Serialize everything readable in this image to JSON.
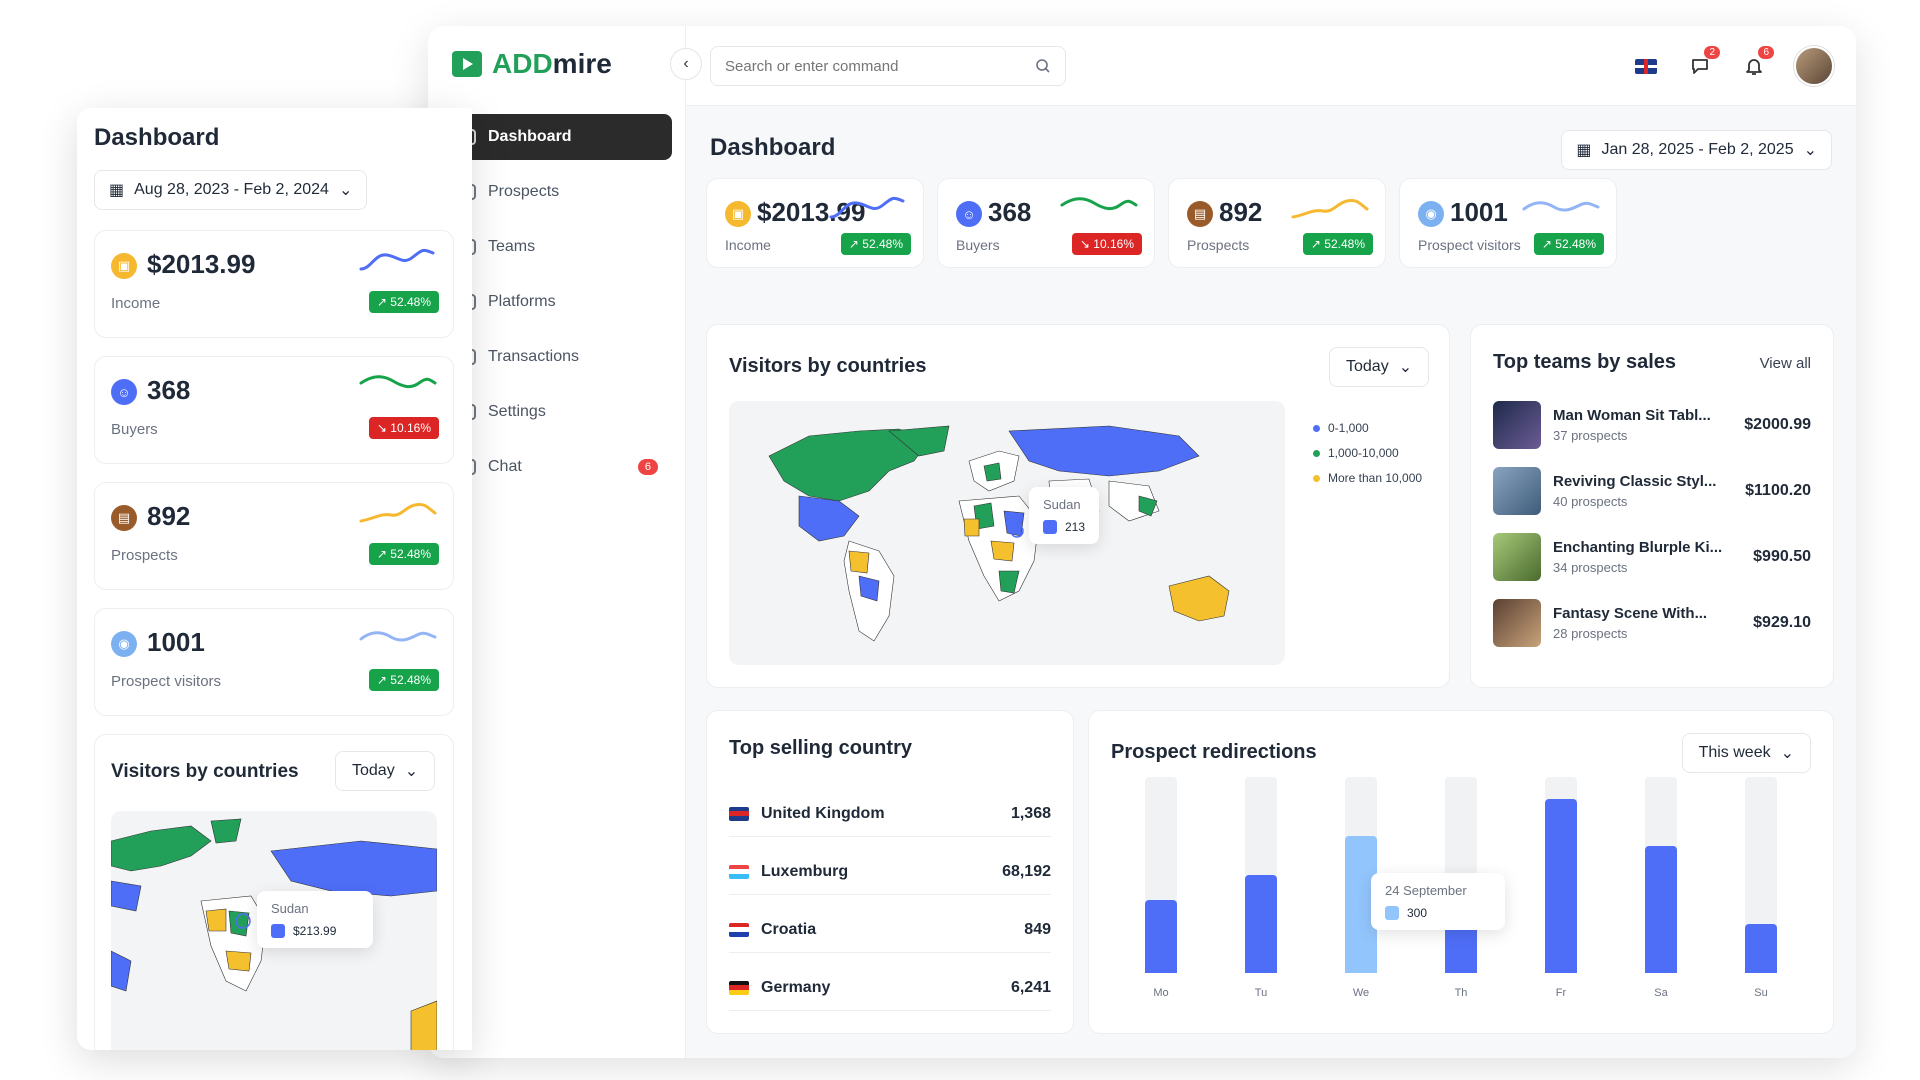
{
  "app": {
    "brand_green": "ADD",
    "brand_dark": "mire"
  },
  "nav": {
    "items": [
      {
        "label": "Dashboard",
        "active": true
      },
      {
        "label": "Prospects"
      },
      {
        "label": "Teams"
      },
      {
        "label": "Platforms"
      },
      {
        "label": "Transactions"
      },
      {
        "label": "Settings"
      },
      {
        "label": "Chat",
        "badge": "6"
      }
    ]
  },
  "topbar": {
    "search_placeholder": "Search or enter command",
    "messages_badge": "2",
    "notifications_badge": "6"
  },
  "main": {
    "title": "Dashboard",
    "date_range": "Jan 28, 2025 - Feb 2, 2025",
    "kpis": [
      {
        "value": "$2013.99",
        "label": "Income",
        "change": "52.48%",
        "trend": "up",
        "color": "#4f6ef7",
        "icon_color": "#f5b82e"
      },
      {
        "value": "368",
        "label": "Buyers",
        "change": "10.16%",
        "trend": "down",
        "color": "#16a34a",
        "icon_color": "#4f6ef7"
      },
      {
        "value": "892",
        "label": "Prospects",
        "change": "52.48%",
        "trend": "up",
        "color": "#f5b82e",
        "icon_color": "#9a5b2a"
      },
      {
        "value": "1001",
        "label": "Prospect visitors",
        "change": "52.48%",
        "trend": "up",
        "color": "#93b4f5",
        "icon_color": "#7cb0f0"
      }
    ],
    "visitors": {
      "title": "Visitors by countries",
      "period": "Today",
      "legend": [
        {
          "label": "0-1,000",
          "color": "#4f6ef7"
        },
        {
          "label": "1,000-10,000",
          "color": "#22a05a"
        },
        {
          "label": "More than 10,000",
          "color": "#f5c02e"
        }
      ],
      "tooltip_country": "Sudan",
      "tooltip_value": "213"
    },
    "top_teams": {
      "title": "Top teams by sales",
      "view_all": "View all",
      "items": [
        {
          "name": "Man Woman Sit Tabl...",
          "sub": "37 prospects",
          "price": "$2000.99"
        },
        {
          "name": "Reviving Classic Styl...",
          "sub": "40 prospects",
          "price": "$1100.20"
        },
        {
          "name": "Enchanting Blurple Ki...",
          "sub": "34 prospects",
          "price": "$990.50"
        },
        {
          "name": "Fantasy Scene With...",
          "sub": "28 prospects",
          "price": "$929.10"
        }
      ]
    },
    "top_selling": {
      "title": "Top selling country",
      "items": [
        {
          "country": "United Kingdom",
          "value": "1,368"
        },
        {
          "country": "Luxemburg",
          "value": "68,192"
        },
        {
          "country": "Croatia",
          "value": "849"
        },
        {
          "country": "Germany",
          "value": "6,241"
        }
      ]
    },
    "redirections": {
      "title": "Prospect redirections",
      "period": "This week",
      "tooltip_date": "24 September",
      "tooltip_value": "300"
    }
  },
  "left": {
    "title": "Dashboard",
    "date_range": "Aug 28, 2023 - Feb 2, 2024",
    "kpis": [
      {
        "value": "$2013.99",
        "label": "Income",
        "change": "52.48%"
      },
      {
        "value": "368",
        "label": "Buyers",
        "change": "10.16%"
      },
      {
        "value": "892",
        "label": "Prospects",
        "change": "52.48%"
      },
      {
        "value": "1001",
        "label": "Prospect visitors",
        "change": "52.48%"
      }
    ],
    "visitors_title": "Visitors by countries",
    "visitors_period": "Today",
    "tooltip_country": "Sudan",
    "tooltip_value": "$213.99"
  },
  "chart_data": {
    "type": "bar",
    "categories": [
      "Mo",
      "Tu",
      "We",
      "Th",
      "Fr",
      "Sa",
      "Su"
    ],
    "values": [
      37,
      50,
      70,
      40,
      89,
      65,
      25
    ],
    "ylim": [
      0,
      100
    ],
    "highlight_index": 2,
    "grid": false
  }
}
